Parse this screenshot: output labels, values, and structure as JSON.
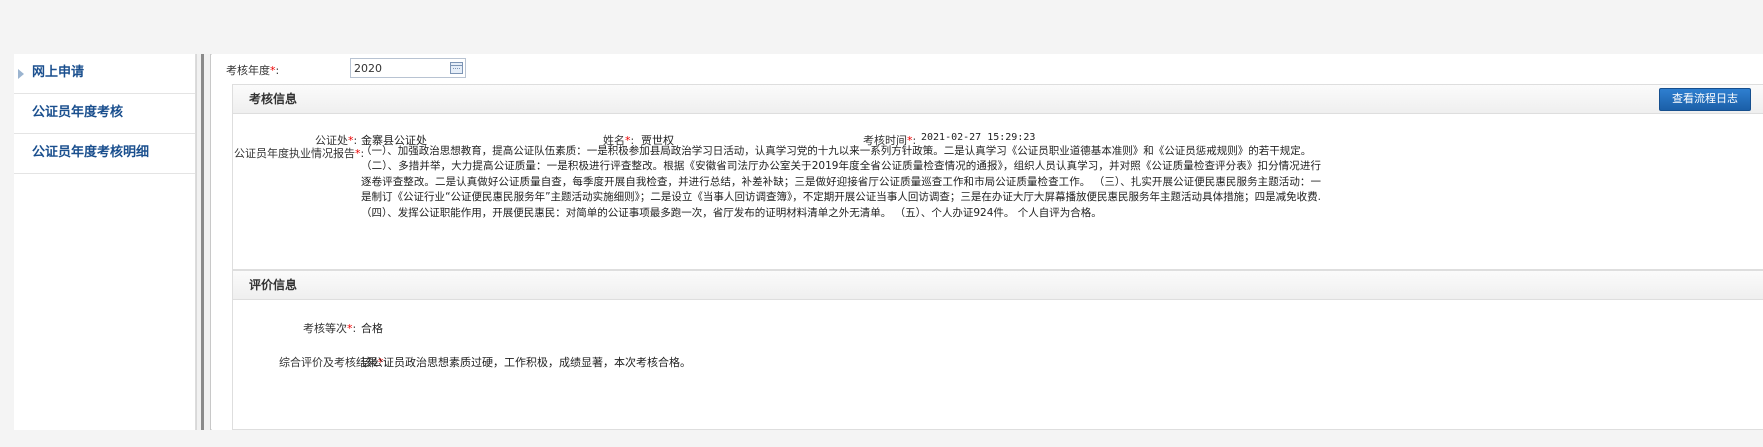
{
  "sidebar": {
    "items": [
      {
        "label": "网上申请",
        "active": true
      },
      {
        "label": "公证员年度考核"
      },
      {
        "label": "公证员年度考核明细"
      }
    ]
  },
  "form": {
    "year_label": "考核年度",
    "year_value": "2020"
  },
  "assessment_info": {
    "title": "考核信息",
    "view_log_button": "查看流程日志",
    "office_label": "公证处",
    "office_value": "金寨县公证处",
    "name_label": "姓名",
    "name_value": "贾世权",
    "time_label": "考核时间",
    "time_value": "2021-02-27 15:29:23",
    "report_label": "公证员年度执业情况报告",
    "report_paragraphs": [
      "（一）、加强政治思想教育，提高公证队伍素质：一是积极参加县局政治学习日活动，认真学习党的十九以来一系列方针政策。二是认真学习《公证员职业道德基本准则》和《公证员惩戒规则》的若干规定。",
      "（二）、多措并举，大力提高公证质量：一是积极进行评查整改。根据《安徽省司法厅办公室关于2019年度全省公证质量检查情况的通报》，组织人员认真学习，并对照《公证质量检查评分表》扣分情况进行逐卷评查整改。二是认真做好公证质量自查，每季度开展自我检查，并进行总结，补差补缺；三是做好迎接省厅公证质量巡查工作和市局公证质量检查工作。 （三）、扎实开展公证便民惠民服务主题活动：一是制订《公证行业“公证便民惠民服务年”主题活动实施细则》；二是设立《当事人回访调查簿》，不定期开展公证当事人回访调查；三是在办证大厅大屏幕播放便民惠民服务年主题活动具体措施；四是减免收费. （四）、发挥公证职能作用，开展便民惠民：对简单的公证事项最多跑一次，省厅发布的证明材料清单之外无清单。 （五）、个人办证924件。 个人自评为合格。"
    ]
  },
  "evaluation_info": {
    "title": "评价信息",
    "grade_label": "考核等次",
    "grade_value": "合格",
    "result_label": "综合评价及考核结果",
    "result_value": "该公证员政治思想素质过硬，工作积极，成绩显著，本次考核合格。"
  },
  "colors": {
    "accent_link": "#1a4f8e",
    "button_bg": "#1b5fa8",
    "required_mark": "#e00000"
  }
}
